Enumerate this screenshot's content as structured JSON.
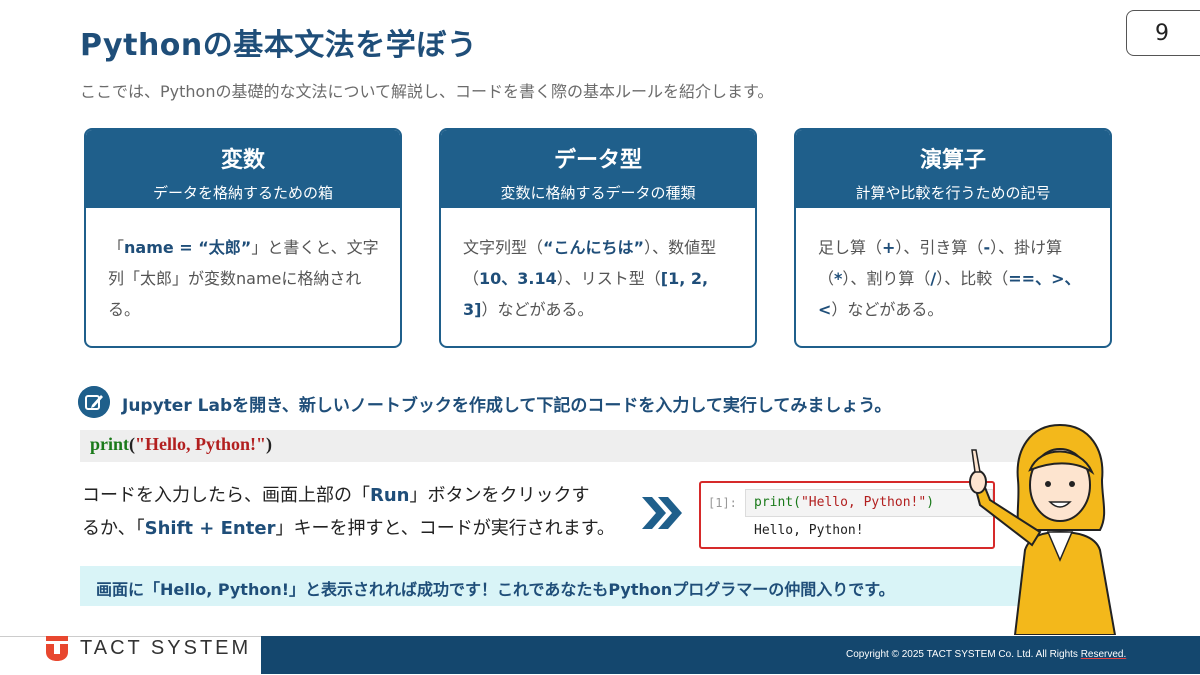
{
  "slide": {
    "title": "Pythonの基本文法を学ぼう",
    "page_number": "9",
    "subtitle": "ここでは、Pythonの基礎的な文法について解説し、コードを書く際の基本ルールを紹介します。"
  },
  "cards": [
    {
      "title": "変数",
      "subtitle": "データを格納するための箱",
      "body": [
        {
          "t": "「"
        },
        {
          "t": "name = “太郎”",
          "b": true
        },
        {
          "t": "」と書くと、文字列「太郎」が変数nameに格納される。"
        }
      ]
    },
    {
      "title": "データ型",
      "subtitle": "変数に格納するデータの種類",
      "body": [
        {
          "t": "文字列型（"
        },
        {
          "t": "“こんにちは”",
          "b": true
        },
        {
          "t": "）、数値型（"
        },
        {
          "t": "10、3.14",
          "b": true
        },
        {
          "t": "）、リスト型（"
        },
        {
          "t": "[1, 2, 3]",
          "b": true
        },
        {
          "t": "）などがある。"
        }
      ]
    },
    {
      "title": "演算子",
      "subtitle": "計算や比較を行うための記号",
      "body": [
        {
          "t": "足し算（"
        },
        {
          "t": "+",
          "b": true
        },
        {
          "t": "）、引き算（"
        },
        {
          "t": "-",
          "b": true
        },
        {
          "t": "）、掛け算（"
        },
        {
          "t": "*",
          "b": true
        },
        {
          "t": "）、割り算（"
        },
        {
          "t": "/",
          "b": true
        },
        {
          "t": "）、比較（"
        },
        {
          "t": "==、>、<",
          "b": true
        },
        {
          "t": "）などがある。"
        }
      ]
    }
  ],
  "task": {
    "icon": "edit-icon",
    "text": "Jupyter Labを開き、新しいノートブックを作成して下記のコードを入力して実行してみましょう。"
  },
  "code": {
    "fn": "print",
    "open": "(",
    "str": "\"Hello, Python!\"",
    "close": ")"
  },
  "instruction": [
    {
      "t": "コードを入力したら、画面上部の「"
    },
    {
      "t": "Run",
      "b": true
    },
    {
      "t": "」ボタンをクリックす"
    },
    {
      "t": "\n"
    },
    {
      "t": "るか、「"
    },
    {
      "t": "Shift + Enter",
      "b": true
    },
    {
      "t": "」キーを押すと、コードが実行されます。"
    }
  ],
  "result": {
    "prompt": "[1]:",
    "code_fn": "print(",
    "code_str": "\"Hello, Python!\"",
    "code_close": ")",
    "output": "Hello, Python!"
  },
  "success": "画面に「Hello, Python!」と表示されれば成功です！これであなたもPythonプログラマーの仲間入りです。",
  "footer": {
    "logo_text": "TACT SYSTEM",
    "copyright_main": "Copyright © 2025 TACT SYSTEM Co. Ltd. All Rights ",
    "copyright_underlined": "Reserved."
  },
  "colors": {
    "primary": "#1f4e79",
    "card_header": "#1f5f8b",
    "footer_bar": "#14476e",
    "success_bg": "#d9f4f7",
    "result_border": "#d62a2a",
    "logo_red": "#e8472f"
  }
}
